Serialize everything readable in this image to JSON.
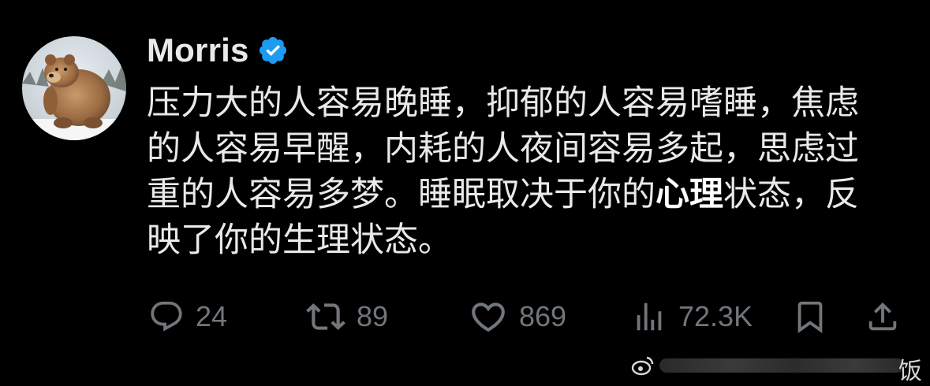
{
  "author": {
    "name": "Morris",
    "verified": true
  },
  "tweet": {
    "line1": "压力大的人容易晚睡，抑郁的人容易嗜睡，焦虑",
    "line2": "的人容易早醒，内耗的人夜间容易多起，思虑过",
    "line3_part1": "重的人容易多梦。睡眠取决于你的",
    "line3_bold": "心理",
    "line3_part2": "状态，反",
    "line4": "映了你的生理状态。"
  },
  "stats": {
    "replies": "24",
    "reposts": "89",
    "likes": "869",
    "views": "72.3K"
  },
  "watermark": {
    "trailing_char": "饭"
  },
  "colors": {
    "background": "#000000",
    "text": "#e7e9ea",
    "muted": "#71767b",
    "verified_blue": "#1d9bf0"
  },
  "icons": {
    "reply": "speech-bubble-icon",
    "repost": "repost-arrows-icon",
    "like": "heart-icon",
    "views": "bar-chart-icon",
    "bookmark": "bookmark-icon",
    "share": "share-upload-icon",
    "verified": "verified-badge-icon"
  }
}
